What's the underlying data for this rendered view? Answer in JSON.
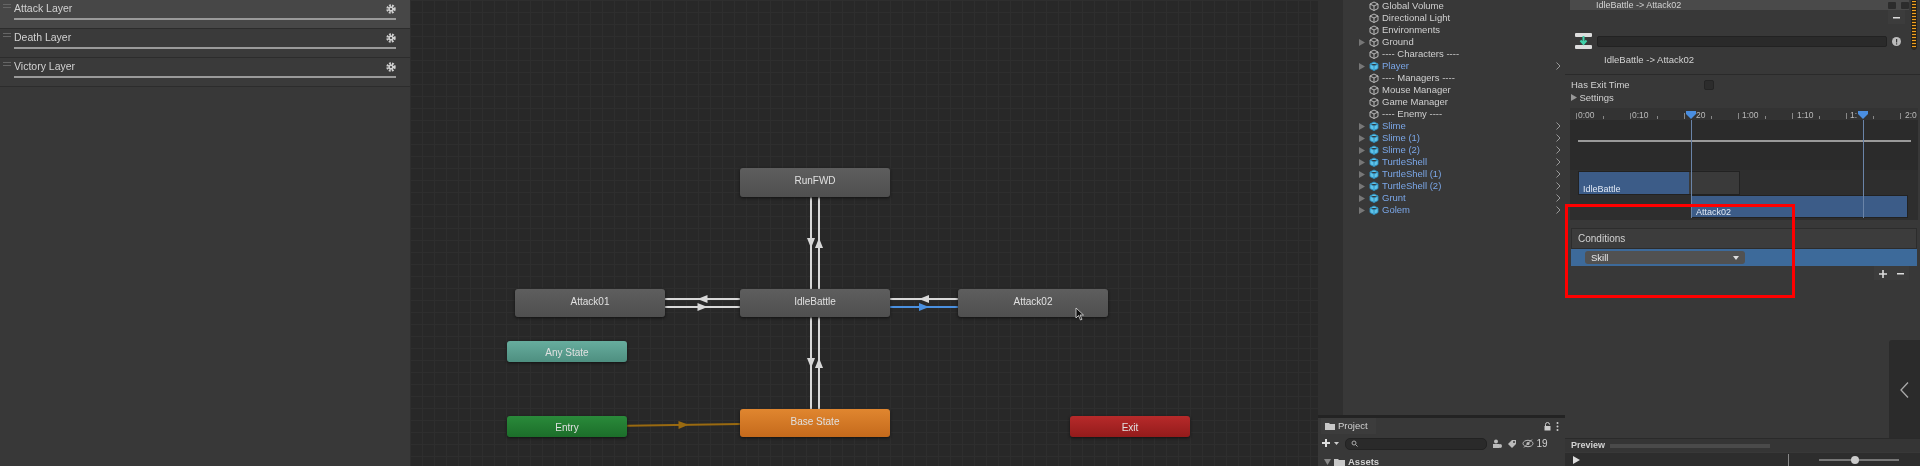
{
  "layers": [
    {
      "name": "Attack Layer",
      "selected": true,
      "level": 1
    },
    {
      "name": "Death Layer",
      "selected": false,
      "level": 1
    },
    {
      "name": "Victory Layer",
      "selected": false,
      "level": 1
    }
  ],
  "graph": {
    "states": [
      {
        "label": "RunFWD",
        "kind": "state"
      },
      {
        "label": "Attack01",
        "kind": "state"
      },
      {
        "label": "IdleBattle",
        "kind": "state"
      },
      {
        "label": "Attack02",
        "kind": "state"
      },
      {
        "label": "Any State",
        "kind": "any"
      },
      {
        "label": "Entry",
        "kind": "entry"
      },
      {
        "label": "Base State",
        "kind": "default"
      },
      {
        "label": "Exit",
        "kind": "exit"
      }
    ],
    "transitions": [
      {
        "selected": false
      },
      {
        "selected": false
      },
      {
        "selected": false
      },
      {
        "selected": false
      },
      {
        "selected": false
      },
      {
        "selected": true
      },
      {
        "selected": false
      },
      {
        "selected": false
      },
      {
        "selected": false
      }
    ]
  },
  "hierarchy": {
    "items": [
      {
        "label": "Global Volume",
        "kind": "object",
        "expandable": false
      },
      {
        "label": "Directional Light",
        "kind": "object",
        "expandable": false
      },
      {
        "label": "Environments",
        "kind": "object",
        "expandable": false
      },
      {
        "label": "Ground",
        "kind": "object",
        "expandable": true
      },
      {
        "label": "---- Characters ----",
        "kind": "object",
        "expandable": false
      },
      {
        "label": "Player",
        "kind": "prefab",
        "expandable": true
      },
      {
        "label": "---- Managers ----",
        "kind": "object",
        "expandable": false
      },
      {
        "label": "Mouse Manager",
        "kind": "object",
        "expandable": false
      },
      {
        "label": "Game Manager",
        "kind": "object",
        "expandable": false
      },
      {
        "label": "---- Enemy ----",
        "kind": "object",
        "expandable": false
      },
      {
        "label": "Slime",
        "kind": "prefab",
        "expandable": true
      },
      {
        "label": "Slime (1)",
        "kind": "prefab",
        "expandable": true
      },
      {
        "label": "Slime (2)",
        "kind": "prefab",
        "expandable": true
      },
      {
        "label": "TurtleShell",
        "kind": "prefab",
        "expandable": true
      },
      {
        "label": "TurtleShell (1)",
        "kind": "prefab",
        "expandable": true
      },
      {
        "label": "TurtleShell (2)",
        "kind": "prefab",
        "expandable": true
      },
      {
        "label": "Grunt",
        "kind": "prefab",
        "expandable": true
      },
      {
        "label": "Golem",
        "kind": "prefab",
        "expandable": true
      }
    ]
  },
  "project": {
    "tab": "Project",
    "hidden_count": "19",
    "tree": [
      {
        "label": "Assets",
        "expanded": true
      }
    ]
  },
  "inspector": {
    "transition_item": {
      "label": "IdleBattle -> Attack02",
      "solo": false,
      "mute": false
    },
    "title": "IdleBattle -> Attack02",
    "has_exit_time": {
      "label": "Has Exit Time",
      "checked": false
    },
    "settings": {
      "label": "Settings",
      "expanded": false
    },
    "timeline": {
      "ticks": [
        "0:00",
        "0:10",
        "20",
        "1:00",
        "1:10",
        "1:",
        "2:0"
      ],
      "clips": [
        {
          "label": "IdleBattle"
        },
        {
          "label": "Attack02"
        }
      ]
    },
    "conditions": {
      "title": "Conditions",
      "items": [
        {
          "parameter": "Skill",
          "selected": true
        }
      ]
    },
    "preview": {
      "label": "Preview",
      "speed": {
        "level": 0.45
      }
    }
  }
}
